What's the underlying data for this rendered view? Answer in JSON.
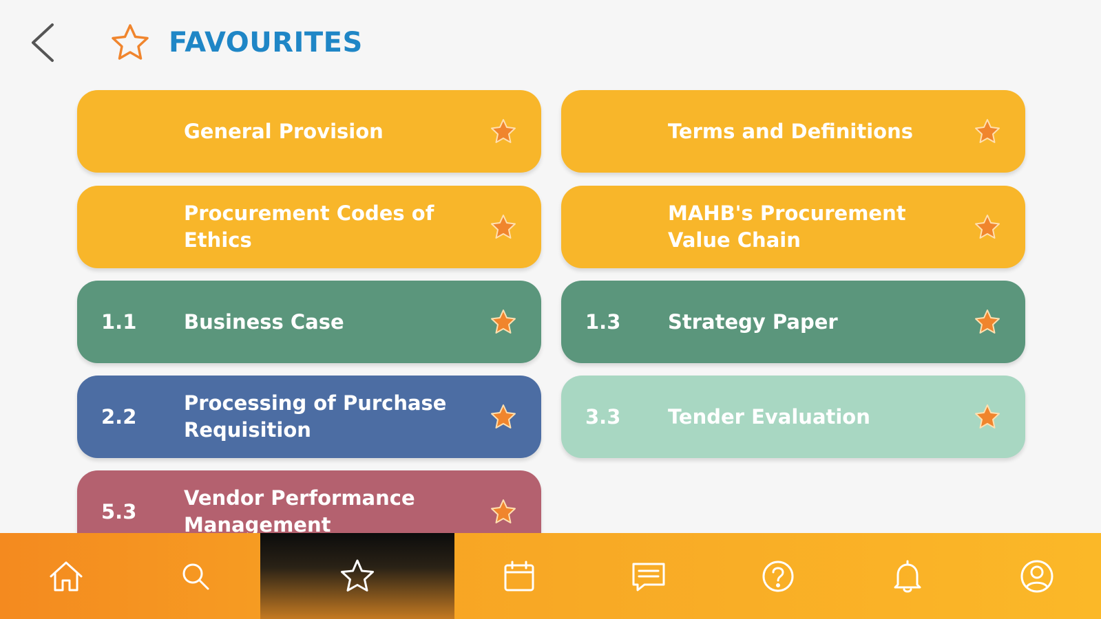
{
  "header": {
    "title": "FAVOURITES"
  },
  "colors": {
    "title": "#1f86c6",
    "orange_star": "#f0852d",
    "yellow": "#f8b62a",
    "green": "#5b967c",
    "blue": "#4c6da3",
    "mint": "#a8d7c2",
    "rose": "#b4616f"
  },
  "favourites": [
    {
      "number": "",
      "label": "General Provision",
      "color": "yellow",
      "star": "star-icon"
    },
    {
      "number": "",
      "label": "Terms and Definitions",
      "color": "yellow",
      "star": "star-icon"
    },
    {
      "number": "",
      "label": "Procurement Codes of Ethics",
      "color": "yellow",
      "star": "star-icon"
    },
    {
      "number": "",
      "label": "MAHB's Procurement Value Chain",
      "color": "yellow",
      "star": "star-icon"
    },
    {
      "number": "1.1",
      "label": "Business Case",
      "color": "green",
      "star": "star-icon"
    },
    {
      "number": "1.3",
      "label": "Strategy Paper",
      "color": "green",
      "star": "star-icon"
    },
    {
      "number": "2.2",
      "label": "Processing of Purchase Requisition",
      "color": "blue",
      "star": "star-icon"
    },
    {
      "number": "3.3",
      "label": "Tender Evaluation",
      "color": "mint",
      "star": "star-icon"
    },
    {
      "number": "5.3",
      "label": "Vendor Performance Management",
      "color": "rose",
      "star": "star-icon"
    }
  ],
  "tabbar": {
    "tabs": [
      {
        "name": "home",
        "icon": "home-icon",
        "active": false
      },
      {
        "name": "search",
        "icon": "search-icon",
        "active": false
      },
      {
        "name": "favourites",
        "icon": "star-icon",
        "active": true
      },
      {
        "name": "calendar",
        "icon": "calendar-icon",
        "active": false
      },
      {
        "name": "messages",
        "icon": "chat-icon",
        "active": false
      },
      {
        "name": "help",
        "icon": "help-icon",
        "active": false
      },
      {
        "name": "notifications",
        "icon": "bell-icon",
        "active": false
      },
      {
        "name": "profile",
        "icon": "user-icon",
        "active": false
      }
    ]
  }
}
